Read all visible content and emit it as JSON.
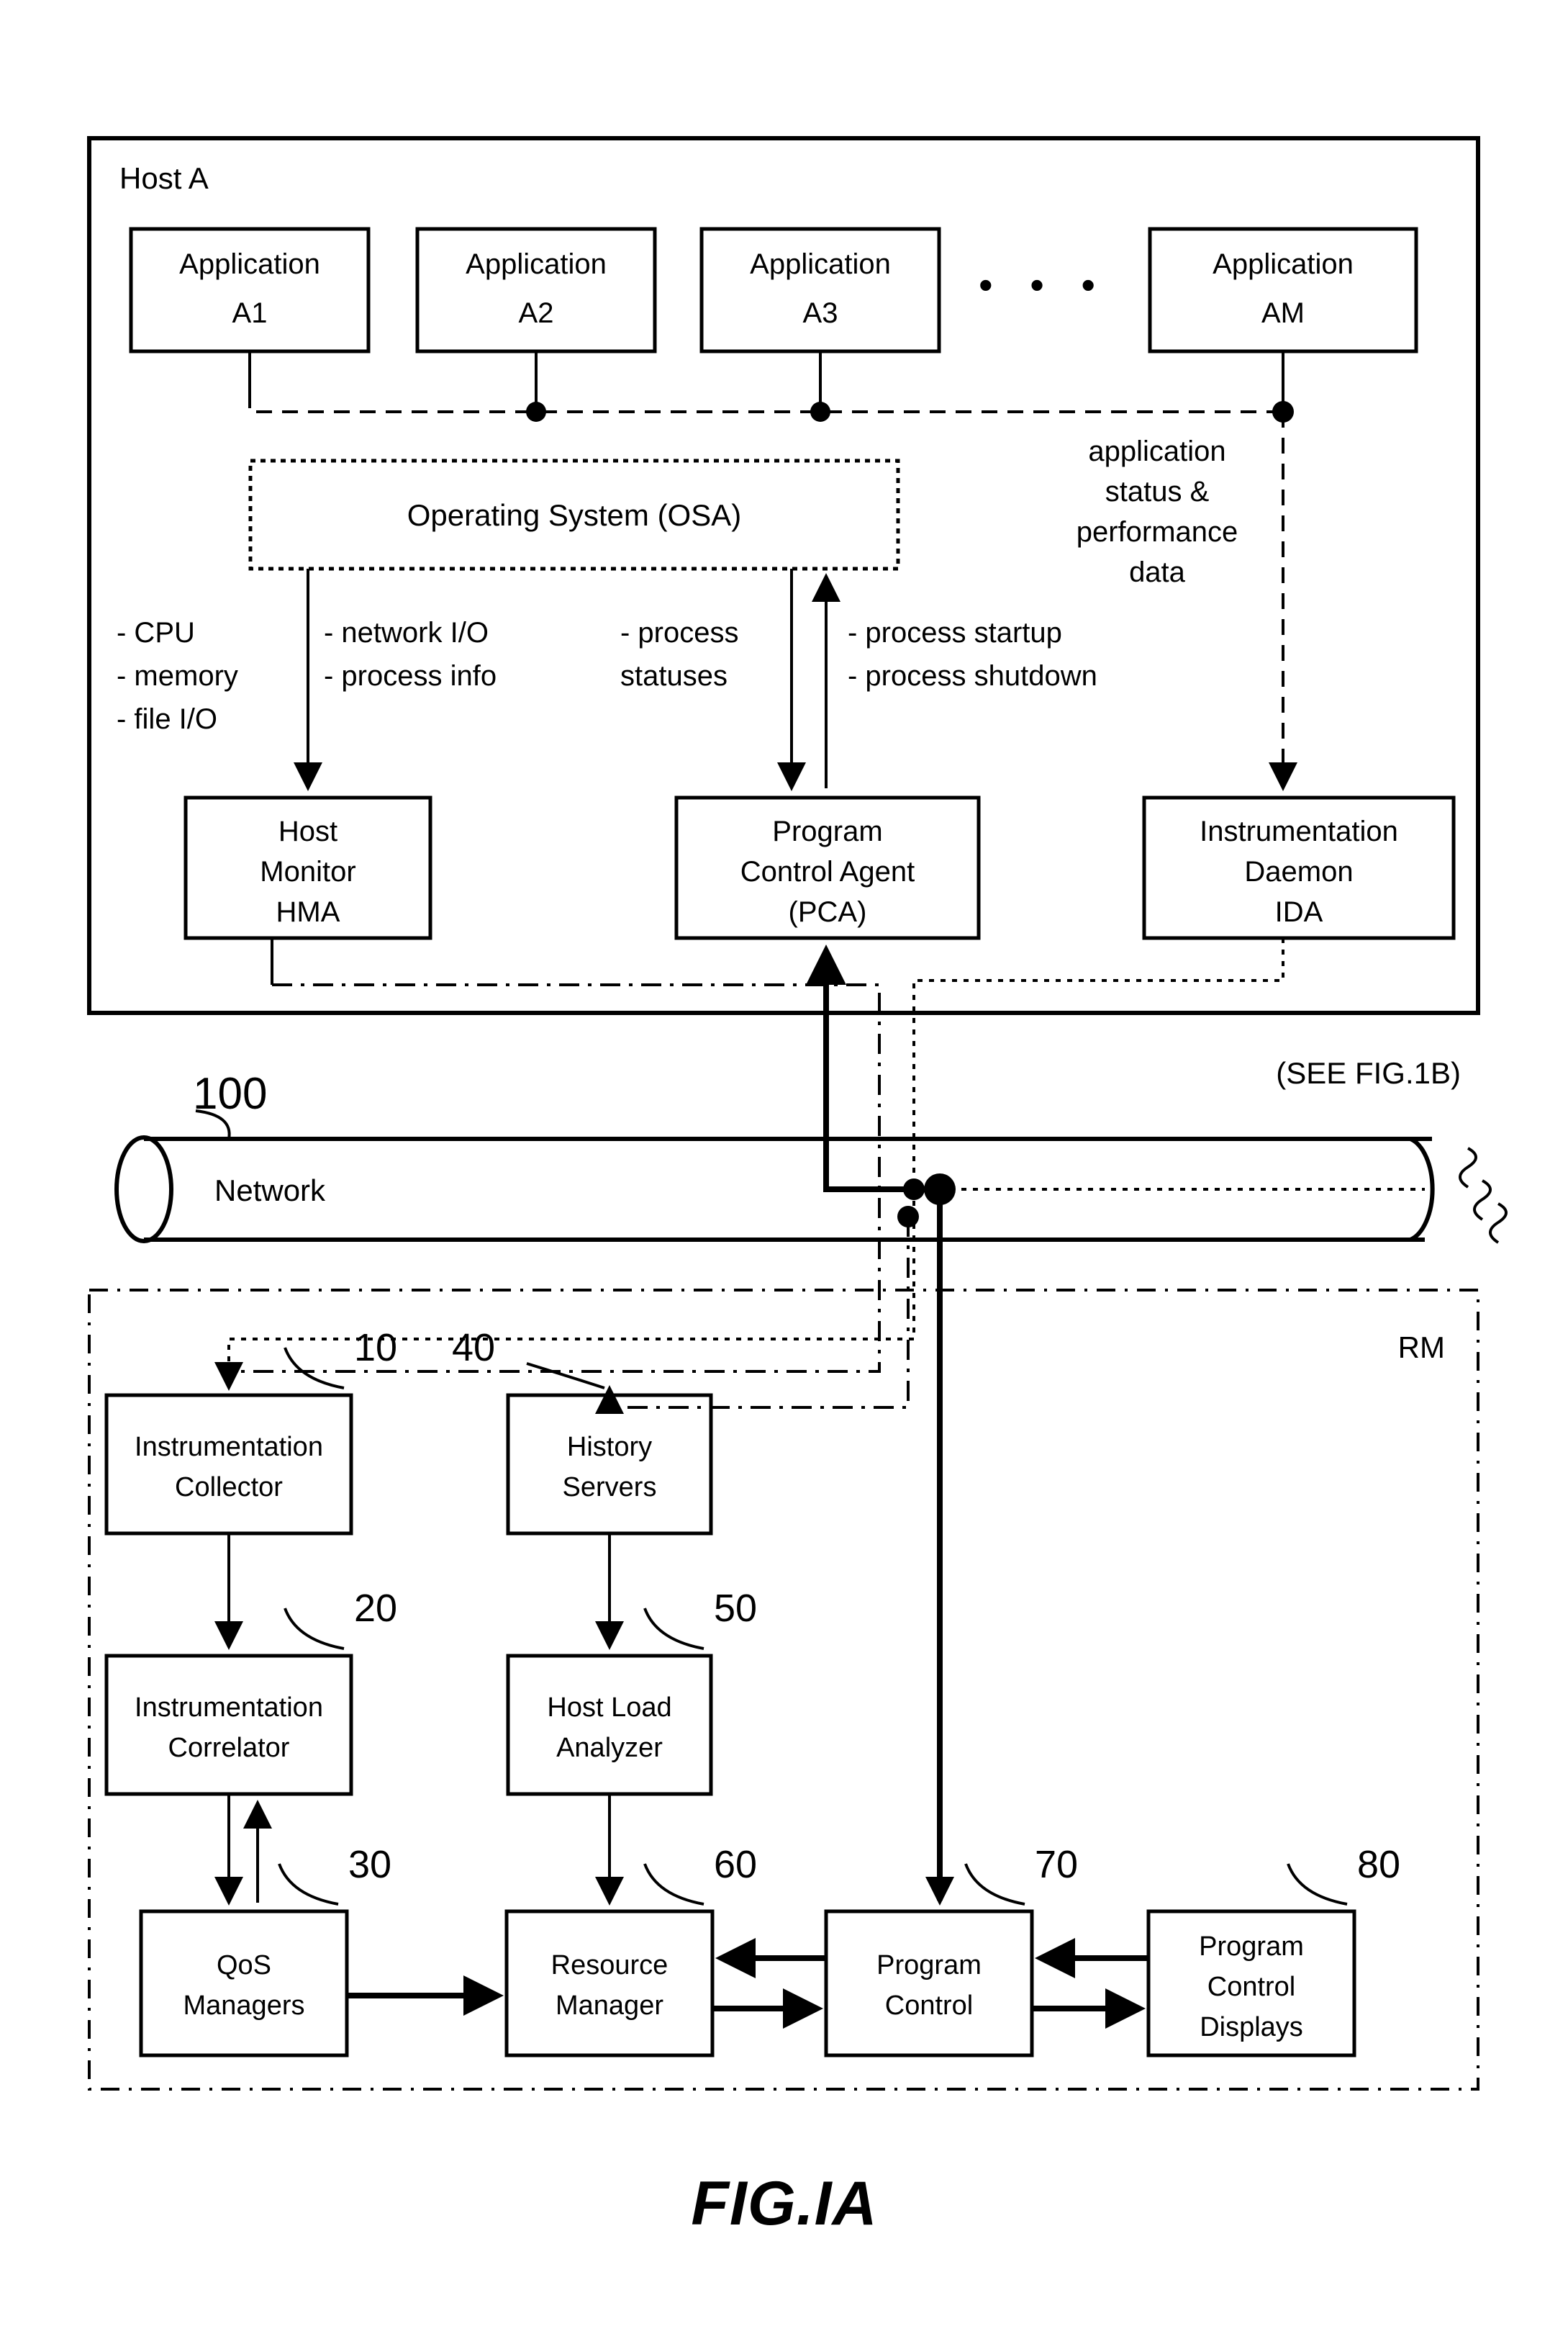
{
  "figure": {
    "caption": "FIG.IA",
    "see_also": "(SEE FIG.1B)"
  },
  "host": {
    "label": "Host A",
    "applications": [
      {
        "line1": "Application",
        "line2": "A1"
      },
      {
        "line1": "Application",
        "line2": "A2"
      },
      {
        "line1": "Application",
        "line2": "A3"
      },
      {
        "line1": "Application",
        "line2": "AM"
      }
    ],
    "ellipsis": "•  •  •",
    "operating_system": "Operating System (OSA)",
    "annotations": {
      "host_metrics": [
        "- CPU",
        "- memory",
        "- file I/O"
      ],
      "os_metrics": [
        "- network I/O",
        "- process info"
      ],
      "process_statuses": [
        "- process",
        "  statuses"
      ],
      "process_control": [
        "- process startup",
        "- process shutdown"
      ],
      "app_data": [
        "application",
        "status &",
        "performance",
        "data"
      ]
    },
    "agents": [
      {
        "line1": "Host",
        "line2": "Monitor",
        "line3": "HMA"
      },
      {
        "line1": "Program",
        "line2": "Control Agent",
        "line3": "(PCA)"
      },
      {
        "line1": "Instrumentation",
        "line2": "Daemon",
        "line3": "IDA"
      }
    ]
  },
  "network": {
    "label": "Network",
    "ref": "100"
  },
  "rm": {
    "label": "RM",
    "components": [
      {
        "ref": "10",
        "line1": "Instrumentation",
        "line2": "Collector"
      },
      {
        "ref": "40",
        "line1": "History",
        "line2": "Servers"
      },
      {
        "ref": "20",
        "line1": "Instrumentation",
        "line2": "Correlator"
      },
      {
        "ref": "50",
        "line1": "Host Load",
        "line2": "Analyzer"
      },
      {
        "ref": "30",
        "line1": "QoS",
        "line2": "Managers"
      },
      {
        "ref": "60",
        "line1": "Resource",
        "line2": "Manager"
      },
      {
        "ref": "70",
        "line1": "Program",
        "line2": "Control"
      },
      {
        "ref": "80",
        "line1": "Program",
        "line2": "Control",
        "line3": "Displays"
      }
    ]
  },
  "colors": {
    "ink": "#000000",
    "paper": "#ffffff"
  }
}
